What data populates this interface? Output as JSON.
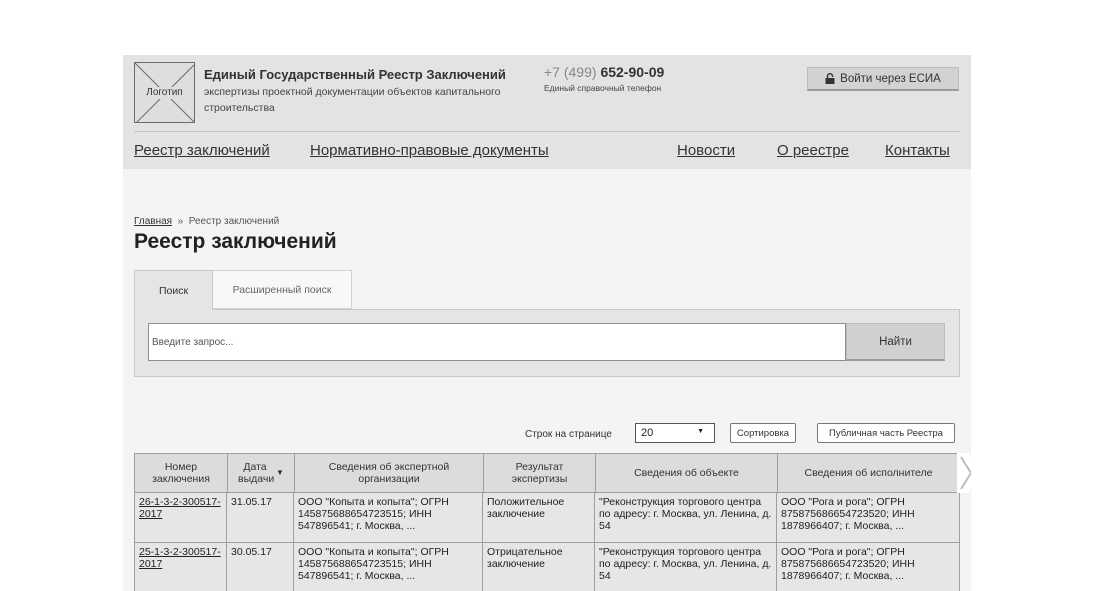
{
  "header": {
    "logo_label": "Логотип",
    "title": "Единый Государственный Реестр Заключений",
    "subtitle": "экспертизы проектной документации объектов капитального строительства",
    "phone_prefix": "+7 (499)",
    "phone_number": "652-90-09",
    "phone_caption": "Единый справочный телефон",
    "login_label": "Войти через ЕСИА",
    "login_icon": "lock-icon"
  },
  "nav": {
    "items": [
      {
        "label": "Реестр заключений"
      },
      {
        "label": "Нормативно-правовые документы"
      },
      {
        "label": "Новости"
      },
      {
        "label": "О реестре"
      },
      {
        "label": "Контакты"
      }
    ]
  },
  "breadcrumb": {
    "home": "Главная",
    "separator": "»",
    "current": "Реестр заключений"
  },
  "page_title": "Реестр заключений",
  "tabs": [
    {
      "label": "Поиск",
      "active": true
    },
    {
      "label": "Расширенный поиск",
      "active": false
    }
  ],
  "search": {
    "placeholder": "Введите запрос...",
    "button_label": "Найти"
  },
  "controls": {
    "rows_label": "Строк на странице",
    "rows_value": "20",
    "sort_label": "Сортировка",
    "public_label": "Публичная часть Реестра"
  },
  "table": {
    "columns": [
      {
        "label": "Номер заключения"
      },
      {
        "label": "Дата выдачи"
      },
      {
        "label": "Сведения об экспертной организации"
      },
      {
        "label": "Результат экспертизы"
      },
      {
        "label": "Сведения об объекте"
      },
      {
        "label": "Сведения об исполнителе"
      }
    ],
    "rows": [
      {
        "number": "26-1-3-2-300517-2017",
        "date": "31.05.17",
        "org": "ООО \"Копыта и копыта\"; ОГРН 145875688654723515; ИНН 547896541; г. Москва, ...",
        "result": "Положительное заключение",
        "object": "\"Реконструкция торгового центра по адресу: г. Москва, ул. Ленина, д. 54",
        "executor": "ООО \"Рога и рога\"; ОГРН 875875686654723520; ИНН 1878966407; г. Москва, ..."
      },
      {
        "number": "25-1-3-2-300517-2017",
        "date": "30.05.17",
        "org": "ООО \"Копыта и копыта\"; ОГРН 145875688654723515; ИНН 547896541; г. Москва, ...",
        "result": "Отрицательное заключение",
        "object": "\"Реконструкция торгового центра по адресу: г. Москва, ул. Ленина, д. 54",
        "executor": "ООО \"Рога и рога\"; ОГРН 875875686654723520; ИНН 1878966407; г. Москва, ..."
      }
    ]
  }
}
